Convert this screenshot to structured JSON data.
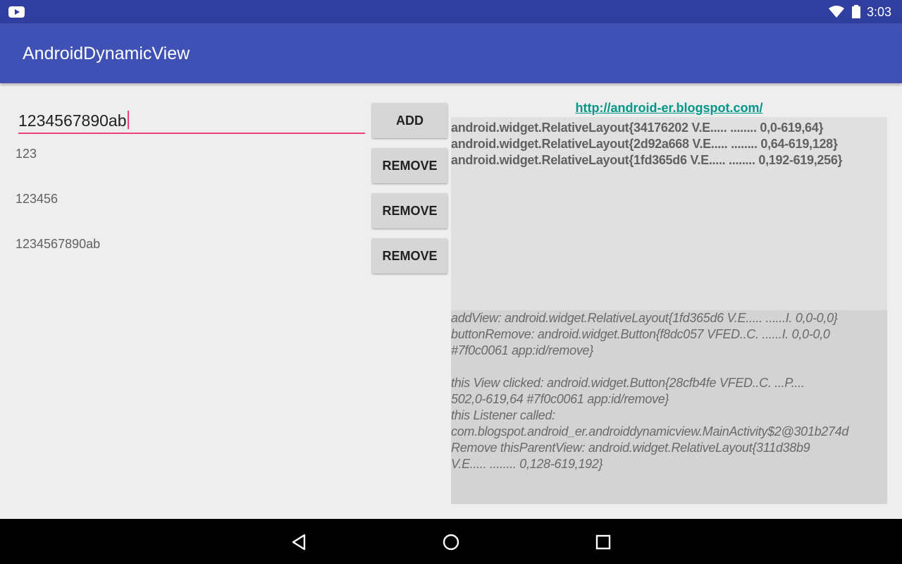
{
  "status_bar": {
    "time": "3:03"
  },
  "app_bar": {
    "title": "AndroidDynamicView"
  },
  "edit": {
    "value": "1234567890ab"
  },
  "add_button": {
    "label": "ADD"
  },
  "rows": [
    {
      "text": "123",
      "button": "REMOVE"
    },
    {
      "text": "123456",
      "button": "REMOVE"
    },
    {
      "text": "1234567890ab",
      "button": "REMOVE"
    }
  ],
  "link": {
    "text": "http://android-er.blogspot.com/"
  },
  "layout_list": [
    "android.widget.RelativeLayout{34176202 V.E..... ........ 0,0-619,64}",
    "android.widget.RelativeLayout{2d92a668 V.E..... ........ 0,64-619,128}",
    "android.widget.RelativeLayout{1fd365d6 V.E..... ........ 0,192-619,256}"
  ],
  "log": [
    "addView: android.widget.RelativeLayout{1fd365d6 V.E..... ......I. 0,0-0,0}",
    "buttonRemove:   android.widget.Button{f8dc057 VFED..C. ......I. 0,0-0,0",
    "#7f0c0061 app:id/remove}",
    "",
    "this View clicked:   android.widget.Button{28cfb4fe VFED..C. ...P....",
    "502,0-619,64 #7f0c0061 app:id/remove}",
    "this Listener called:",
    "com.blogspot.android_er.androiddynamicview.MainActivity$2@301b274d",
    "Remove thisParentView: android.widget.RelativeLayout{311d38b9",
    "V.E..... ........ 0,128-619,192}"
  ],
  "colors": {
    "status_bar": "#303f9f",
    "app_bar": "#3f51b5",
    "accent": "#ec407a",
    "link": "#009688"
  },
  "icons": {
    "status": [
      "youtube-icon",
      "wifi-icon",
      "battery-icon"
    ],
    "nav": [
      "back-icon",
      "home-icon",
      "recents-icon"
    ]
  }
}
